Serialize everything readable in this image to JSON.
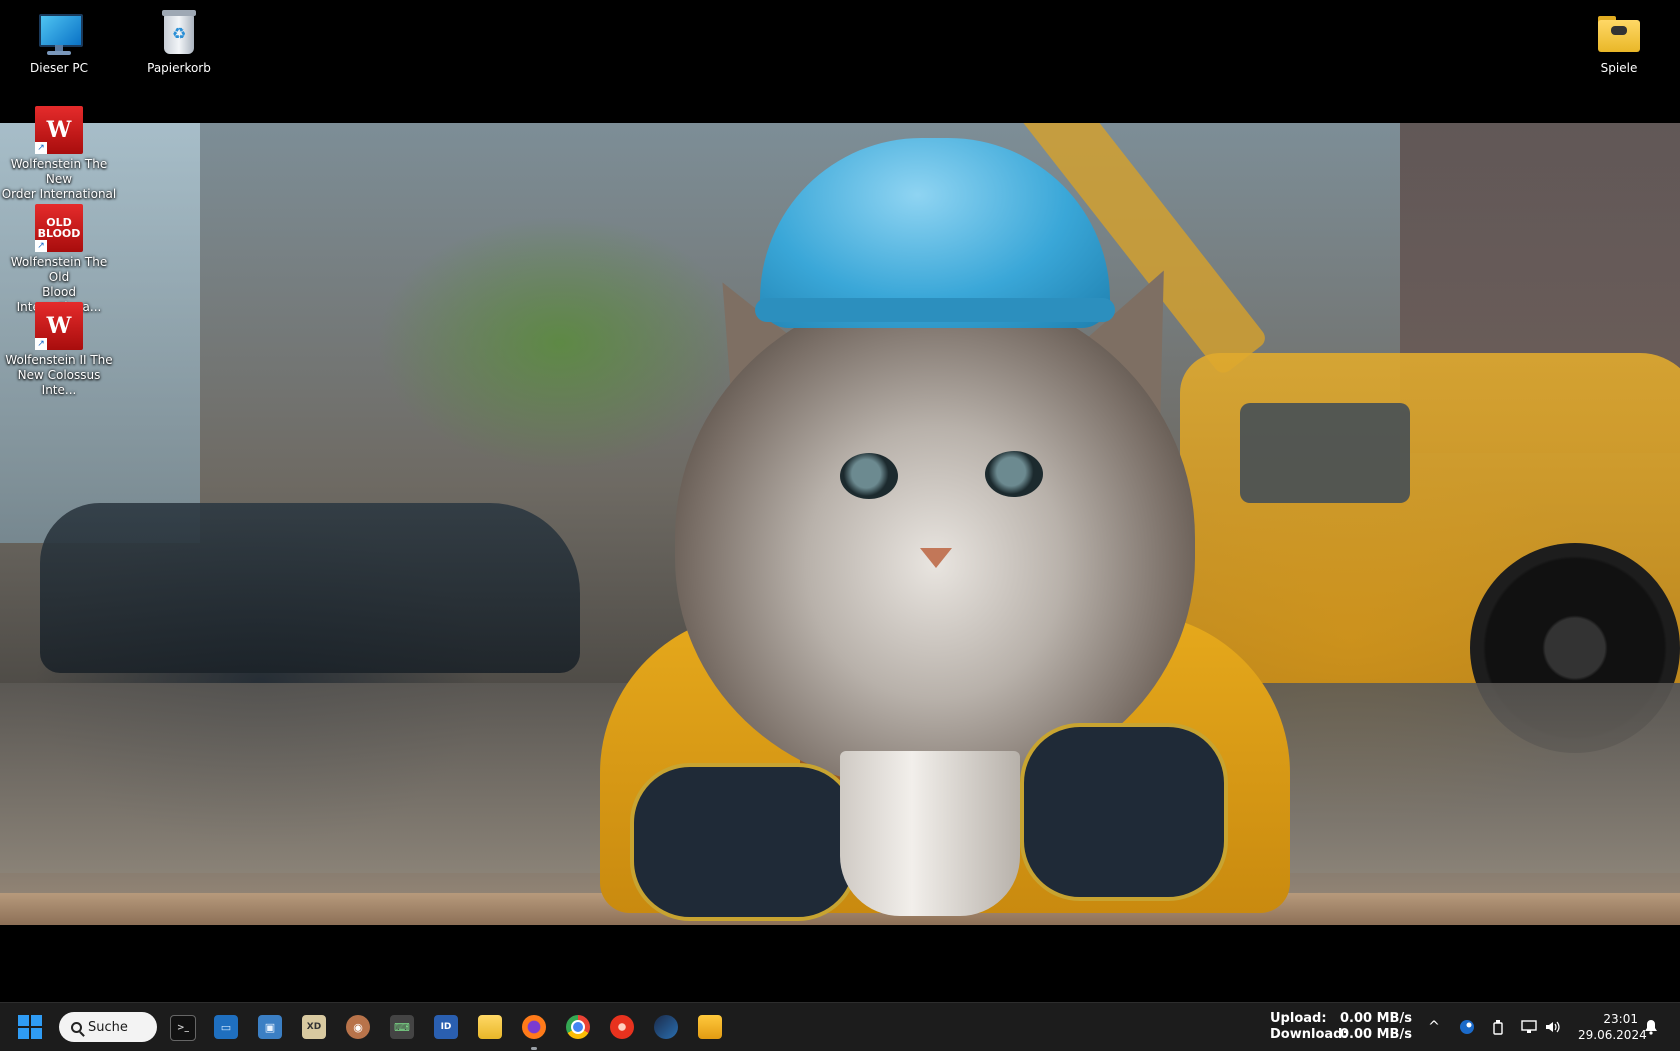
{
  "desktop": {
    "icons": [
      {
        "label": "Dieser PC",
        "icon": "this-pc-icon"
      },
      {
        "label": "Papierkorb",
        "icon": "recycle-bin-icon"
      },
      {
        "label": "Spiele",
        "icon": "folder-icon"
      },
      {
        "label_line1": "Wolfenstein The New",
        "label_line2": "Order International ...",
        "icon": "wolfenstein-new-order-icon",
        "badge": "W"
      },
      {
        "label_line1": "Wolfenstein The Old",
        "label_line2": "Blood Internationa...",
        "icon": "wolfenstein-old-blood-icon",
        "badge_line1": "OLD",
        "badge_line2": "BLOOD"
      },
      {
        "label_line1": "Wolfenstein II The",
        "label_line2": "New Colossus Inte...",
        "icon": "wolfenstein-new-colossus-icon",
        "badge": "W"
      }
    ]
  },
  "taskbar": {
    "start_icon": "windows-start-icon",
    "search_label": "Suche",
    "apps": [
      {
        "name": "terminal",
        "icon": "terminal-icon",
        "glyph": ">_"
      },
      {
        "name": "app-blue",
        "icon": "blue-app-icon",
        "glyph": "▭"
      },
      {
        "name": "image-viewer",
        "icon": "photo-app-icon",
        "glyph": "▣"
      },
      {
        "name": "xd-tool",
        "icon": "xd-app-icon",
        "glyph": "XD"
      },
      {
        "name": "avatar-app",
        "icon": "avatar-app-icon",
        "glyph": "◉"
      },
      {
        "name": "keyboard-app",
        "icon": "keyboard-app-icon",
        "glyph": "⌨"
      },
      {
        "name": "id-app",
        "icon": "id-app-icon",
        "glyph": "ID"
      },
      {
        "name": "file-explorer",
        "icon": "file-explorer-icon",
        "glyph": ""
      },
      {
        "name": "firefox",
        "icon": "firefox-icon",
        "glyph": ""
      },
      {
        "name": "chrome",
        "icon": "chrome-icon",
        "glyph": ""
      },
      {
        "name": "media-player",
        "icon": "red-circle-app-icon",
        "glyph": ""
      },
      {
        "name": "steam",
        "icon": "steam-icon",
        "glyph": ""
      },
      {
        "name": "folder",
        "icon": "folder-app-icon",
        "glyph": ""
      }
    ],
    "network": {
      "upload_label": "Upload:",
      "upload_value": "0.00 MB/s",
      "download_label": "Download:",
      "download_value": "0.00 MB/s"
    },
    "tray": {
      "chevron": "^",
      "icons": [
        "steam-tray-icon",
        "usb-drive-icon",
        "network-icon",
        "volume-icon",
        "notification-bell-icon"
      ]
    },
    "clock": {
      "time": "23:01",
      "date": "29.06.2024"
    }
  },
  "colors": {
    "taskbar_bg": "#1c1c1c",
    "start_blue": "#2f9cf5",
    "game_red": "#d41c1c"
  }
}
